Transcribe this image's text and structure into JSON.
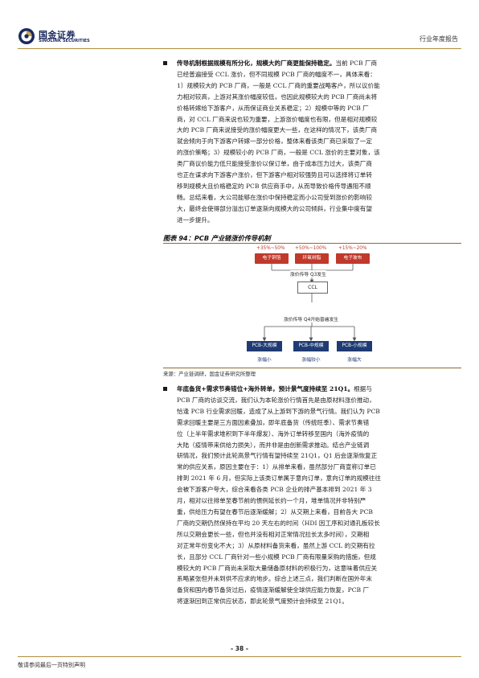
{
  "header": {
    "logo_cn": "国金证券",
    "logo_en": "SINOLINK SECURITIES",
    "report_type": "行业年度报告"
  },
  "para1": {
    "lead": "传导机制根据规模有所分化，规模大的厂商更能保持稳定。",
    "lines": [
      "当前 PCB 厂商",
      "已经普遍接受 CCL 涨价，但不同规模 PCB 厂商的幅度不一，具体来看：",
      "1）规模较大的 PCB 厂商，一般是 CCL 厂商的重要战略客户，所以议价能",
      "力相对较高，上游对其涨价幅度较低，也因此规模较大的 PCB 厂商尚未将",
      "价格转嫁给下游客户，从而保证商业关系稳定；2）规模中等的 PCB 厂",
      "商，对 CCL 厂商来说也较为重要，上游涨价幅度也有限，但是相对规模较",
      "大的 PCB 厂商来说接受的涨价幅度更大一些，在这样的情况下，该类厂商",
      "就会倾向于向下游客户转嫁一部分价格，整体来看该类厂商已采取了一定",
      "的涨价策略；3）规模较小的 PCB 厂商，一般是 CCL 涨价的主要对象，该",
      "类厂商议价能力低只能接受涨价以保订单，由于成本压力过大，该类厂商",
      "也正在谋求向下游客户涨价，但下游客户相对较强势且可以选择将订单转",
      "移到规模大且价格稳定的 PCB 供应商手中，从而导致价格传导遇阻不顺",
      "畅。总结来看，大公司能够在涨价中保持稳定而小公司受到涨价的影响较",
      "大，最终会使得部分溢出订单逐渐向规模大的公司倾斜，行业集中度有望",
      "进一步提升。"
    ]
  },
  "figure": {
    "title": "图表 94：PCB 产业链涨价传导机制",
    "materials": [
      {
        "pct": "+35%~50%",
        "label": "电子铜箔"
      },
      {
        "pct": "+50%~100%",
        "label": "环氧树脂"
      },
      {
        "pct": "+15%~20%",
        "label": "电子玻布"
      }
    ],
    "step1": "涨价传导 Q3发生",
    "ccl": "CCL",
    "step2": "涨价传导 Q4开始普遍发生",
    "pcb": [
      {
        "label": "PCB-大规模",
        "note": "涨幅小"
      },
      {
        "label": "PCB-中规模",
        "note": "涨幅较小"
      },
      {
        "label": "PCB-小规模",
        "note": "涨幅大"
      }
    ],
    "source": "来源：产业链调研，国金证券研究所整理"
  },
  "para2": {
    "lead_a": "年底备货+需求节奏错位+海外转单，",
    "lead_b": "预计景气度持续至 21Q1。",
    "lines": [
      "根据与",
      "PCB 厂商的访谈交流，我们认为本轮涨价行情首先是由原材料涨价推动，",
      "恰逢 PCB 行业需求回暖，造成了从上游到下游的景气行情。我们认为 PCB",
      "需求回暖主要是三方面因素叠加，即年底备货（传统旺季）、需求节奏错",
      "位（上半年需求堆积到下半年爆发）、海外订单转移至国内（海外疫情的",
      "大陆（疫情带来供给力损失），而并非是由创新需求推动。结合产业链调",
      "研情况，我们预计此轮高景气行情有望持续至 21Q1，Q1 后会逐渐恢复正",
      "常的供应关系，原因主要在于：1）从排单来看，虽然部分厂商宣称订单已",
      "排到 2021 年 6 月，但实际上该类订单属于意向订单，意向订单的规模往往",
      "会被下游客户夸大，综合来看各类 PCB 企业的排产基本排到 2021 年 3",
      "月，相对以往排单至春节前的惯例延长约一个月，堆单情况并非特别严",
      "重，供给压力有望在春节后逐渐缓解；2）从交期上来看，目前各大 PCB",
      "厂商的交期仍然保持在平均 20 天左右的时间（HDI 因工序和对通孔板较长",
      "所以交期会更长一些，但也并没有相对正常情况拉长太多时间），交期相",
      "对正常年份变化不大；3）从原材料备货来看，虽然上游 CCL 的交期有拉",
      "长，且部分 CCL 厂商针对一些小规模 PCB 厂商有限量采购的措施，但规",
      "模较大的 PCB 厂商尚未采取大量储备原材料的积极行为，这意味着供应关",
      "系略紧张但并未到供不应求的地步。综合上述三点，我们判断在国外年末",
      "备货和国内春节备货过后，疫情逐渐缓解使全球供应能力恢复，PCB 厂",
      "将逐渐回到正常供应状态，即此轮景气度预计会持续至 21Q1。"
    ]
  },
  "footer": {
    "page": "- 38 -",
    "note": "敬请参阅最后一页特别声明"
  }
}
